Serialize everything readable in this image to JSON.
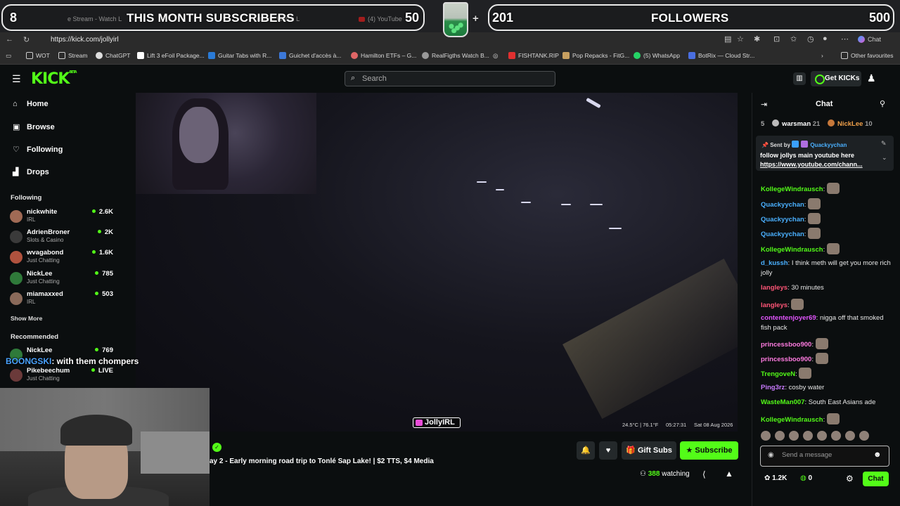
{
  "browser": {
    "tabs": [
      {
        "label": "e Stream - Watch L"
      },
      {
        "label": "ream - Watch L"
      },
      {
        "label": "(4) YouTube"
      }
    ],
    "url": "https://kick.com/jollyirl",
    "copilot_label": "Chat",
    "bookmarks": [
      {
        "label": "WOT"
      },
      {
        "label": "Stream"
      },
      {
        "label": "ChatGPT"
      },
      {
        "label": "Lift 3 eFoil Package..."
      },
      {
        "label": "Guitar Tabs with R..."
      },
      {
        "label": "Guichet d'accès à..."
      },
      {
        "label": "Hamilton ETFs – G..."
      },
      {
        "label": "RealFigths Watch B..."
      },
      {
        "label": "FISHTANK.RIP"
      },
      {
        "label": "Pop Repacks - FitG..."
      },
      {
        "label": "(5) WhatsApp"
      },
      {
        "label": "BotRix — Cloud Str..."
      },
      {
        "label": "Other favourites"
      }
    ]
  },
  "overlay": {
    "subs_count": "8",
    "subs_label": "THIS MONTH SUBSCRIBERS",
    "subs_goal": "50",
    "plus": "+",
    "followers_count": "201",
    "followers_label": "FOLLOWERS",
    "followers_goal": "500",
    "chat_user": "BOONGSKI",
    "chat_text": ": with them chompers"
  },
  "kick": {
    "logo": "KICK",
    "logo_badge": "BETA",
    "search_placeholder": "Search",
    "get_kicks": "Get KICKs"
  },
  "sidebar": {
    "nav": [
      {
        "label": "Home",
        "icon": "home-icon"
      },
      {
        "label": "Browse",
        "icon": "browse-icon"
      },
      {
        "label": "Following",
        "icon": "heart-icon"
      },
      {
        "label": "Drops",
        "icon": "drops-icon"
      }
    ],
    "following_header": "Following",
    "following": [
      {
        "name": "nickwhite",
        "category": "IRL",
        "viewers": "2.6K"
      },
      {
        "name": "AdrienBroner",
        "category": "Slots & Casino",
        "viewers": "2K"
      },
      {
        "name": "wvagabond",
        "category": "Just Chatting",
        "viewers": "1.6K"
      },
      {
        "name": "NickLee",
        "category": "Just Chatting",
        "viewers": "785"
      },
      {
        "name": "miamaxxed",
        "category": "IRL",
        "viewers": "503"
      }
    ],
    "show_more": "Show More",
    "recommended_header": "Recommended",
    "recommended": [
      {
        "name": "NickLee",
        "category": "",
        "viewers": "769"
      },
      {
        "name": "Pikebeechum",
        "category": "Just Chatting",
        "viewers": "LIVE"
      }
    ]
  },
  "video": {
    "streamer_tag": "JollyIRL",
    "osd_temp": "24.5°C | 76.1°F",
    "osd_time": "05:27:31",
    "osd_date": "Sat 08 Aug 2026"
  },
  "stream": {
    "title": "ay 2 - Early morning road trip to Tonlé Sap Lake! | $2 TTS, $4 Media",
    "gift_subs": "Gift Subs",
    "subscribe": "Subscribe",
    "viewers": "388",
    "watching_label": "watching"
  },
  "chat": {
    "title": "Chat",
    "leaderboard": [
      {
        "rank": "5",
        "name": "warsman",
        "score": "21"
      },
      {
        "rank": "",
        "name": "NickLee",
        "score": "10"
      }
    ],
    "pinned": {
      "sent_by_label": "Sent by",
      "sender": "Quackyychan",
      "message": "follow jollys main youtube here",
      "link": "https://www.youtube.com/chann..."
    },
    "messages": [
      {
        "user": "KollegeWindrausch",
        "text": "",
        "color": "#53fc18"
      },
      {
        "user": "Quackyychan",
        "text": "",
        "color": "#4ab0ff"
      },
      {
        "user": "Quackyychan",
        "text": "",
        "color": "#4ab0ff"
      },
      {
        "user": "Quackyychan",
        "text": "",
        "color": "#4ab0ff"
      },
      {
        "user": "KollegeWindrausch",
        "text": "",
        "color": "#53fc18"
      },
      {
        "user": "d_kussh",
        "text": "I think meth will get you more rich jolly",
        "color": "#4ab0ff"
      },
      {
        "user": "langleys",
        "text": "30 minutes",
        "color": "#ff5577"
      },
      {
        "user": "langleys",
        "text": "",
        "color": "#ff5577"
      },
      {
        "user": "contentenjoyer69",
        "text": "nigga off that smoked fish pack",
        "color": "#e255ff"
      },
      {
        "user": "princessboo900",
        "text": "",
        "color": "#ff7be0"
      },
      {
        "user": "princessboo900",
        "text": "",
        "color": "#ff7be0"
      },
      {
        "user": "TrengoveN",
        "text": "",
        "color": "#53fc18"
      },
      {
        "user": "Ping3rz",
        "text": "cosby water",
        "color": "#c97bff"
      },
      {
        "user": "WasteMan007",
        "text": "South East Asians ade",
        "color": "#53fc18"
      },
      {
        "user": "KollegeWindrausch",
        "text": "",
        "color": "#53fc18"
      }
    ],
    "input_placeholder": "Send a message",
    "kicks_balance": "1.2K",
    "points_balance": "0",
    "send_label": "Chat"
  },
  "colors": {
    "accent": "#53fc18",
    "bg": "#0b0e0f",
    "panel": "#24292b"
  }
}
